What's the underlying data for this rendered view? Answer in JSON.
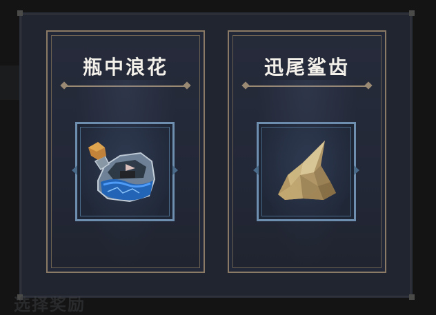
{
  "cards": [
    {
      "title": "瓶中浪花",
      "item_icon": "bottle-wave-icon"
    },
    {
      "title": "迅尾鲨齿",
      "item_icon": "shark-tooth-icon"
    }
  ],
  "footer_text": "选择奖励",
  "colors": {
    "panel_bg": "#212530",
    "card_border": "#8a7a66",
    "item_frame_border": "#6e8fb0",
    "title_text": "#f4f1ea"
  }
}
